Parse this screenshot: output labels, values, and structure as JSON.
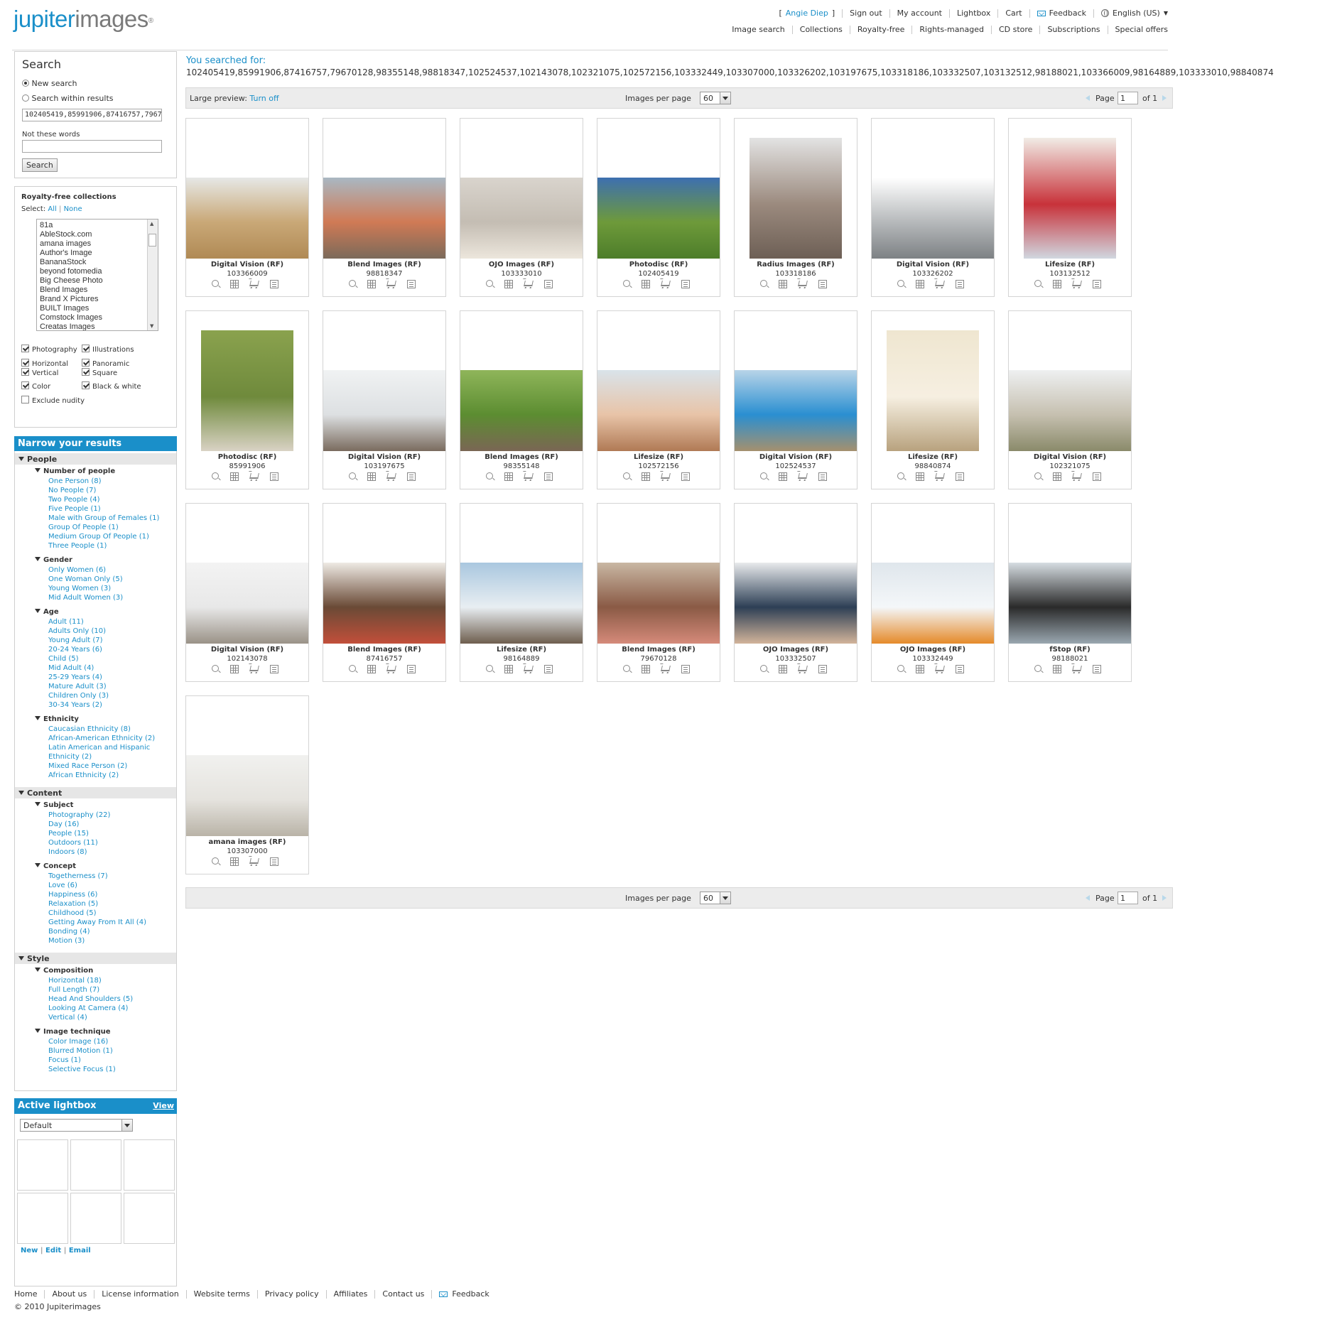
{
  "brand": {
    "logo_part1": "jupiter",
    "logo_part2": "images",
    "reg": "®"
  },
  "header": {
    "user_open": "[",
    "user": "Angie Diep",
    "user_close": "]",
    "top_links": [
      "Sign out",
      "My account",
      "Lightbox",
      "Cart"
    ],
    "feedback": "Feedback",
    "language": "English (US)",
    "nav_links": [
      "Image search",
      "Collections",
      "Royalty-free",
      "Rights-managed",
      "CD store",
      "Subscriptions",
      "Special offers"
    ]
  },
  "search_panel": {
    "title": "Search",
    "new_search": "New search",
    "within_results": "Search within results",
    "query_value": "102405419,85991906,87416757,79670128,98355148,98818347,102524537,102143078,102321075,102572156,103332449,103307000,103326202,103197675,103318186,103332507,103132512,98188021,103366009,98164889,103333010,98840874",
    "not_these_label": "Not these words",
    "not_these_value": "",
    "search_button": "Search"
  },
  "collections_panel": {
    "title": "Royalty-free collections",
    "select_label": "Select:",
    "select_all": "All",
    "select_none": "None",
    "items": [
      "81a",
      "AbleStock.com",
      "amana images",
      "Author's Image",
      "BananaStock",
      "beyond fotomedia",
      "Big Cheese Photo",
      "Blend Images",
      "Brand X Pictures",
      "BUILT Images",
      "Comstock Images",
      "Creatas Images"
    ],
    "filters": [
      {
        "label": "Photography",
        "checked": true
      },
      {
        "label": "Illustrations",
        "checked": true
      },
      {
        "label": "Horizontal",
        "checked": true
      },
      {
        "label": "Panoramic",
        "checked": true
      },
      {
        "label": "Vertical",
        "checked": true
      },
      {
        "label": "Square",
        "checked": true
      },
      {
        "label": "Color",
        "checked": true
      },
      {
        "label": "Black & white",
        "checked": true
      },
      {
        "label": "Exclude nudity",
        "checked": false
      }
    ]
  },
  "narrow": {
    "title": "Narrow your results",
    "sections": [
      {
        "title": "People",
        "groups": [
          {
            "title": "Number of people",
            "items": [
              "One Person (8)",
              "No People (7)",
              "Two People (4)",
              "Five People (1)",
              "Male with Group of Females (1)",
              "Group Of People (1)",
              "Medium Group Of People (1)",
              "Three People (1)"
            ]
          },
          {
            "title": "Gender",
            "items": [
              "Only Women (6)",
              "One Woman Only (5)",
              "Young Women (3)",
              "Mid Adult Women (3)"
            ]
          },
          {
            "title": "Age",
            "items": [
              "Adult (11)",
              "Adults Only (10)",
              "Young Adult (7)",
              "20-24 Years (6)",
              "Child (5)",
              "Mid Adult (4)",
              "25-29 Years (4)",
              "Mature Adult (3)",
              "Children Only (3)",
              "30-34 Years (2)"
            ]
          },
          {
            "title": "Ethnicity",
            "items": [
              "Caucasian Ethnicity (8)",
              "African-American Ethnicity (2)",
              "Latin American and Hispanic",
              "Ethnicity (2)",
              "Mixed Race Person (2)",
              "African Ethnicity (2)"
            ]
          }
        ]
      },
      {
        "title": "Content",
        "groups": [
          {
            "title": "Subject",
            "items": [
              "Photography (22)",
              "Day (16)",
              "People (15)",
              "Outdoors (11)",
              "Indoors (8)"
            ]
          },
          {
            "title": "Concept",
            "items": [
              "Togetherness (7)",
              "Love (6)",
              "Happiness (6)",
              "Relaxation (5)",
              "Childhood (5)",
              "Getting Away From It All (4)",
              "Bonding (4)",
              "Motion (3)"
            ]
          }
        ]
      },
      {
        "title": "Style",
        "groups": [
          {
            "title": "Composition",
            "items": [
              "Horizontal (18)",
              "Full Length (7)",
              "Head And Shoulders (5)",
              "Looking At Camera (4)",
              "Vertical (4)"
            ]
          },
          {
            "title": "Image technique",
            "items": [
              "Color Image (16)",
              "Blurred Motion (1)",
              "Focus (1)",
              "Selective Focus (1)"
            ]
          }
        ]
      }
    ]
  },
  "lightbox": {
    "title": "Active lightbox",
    "view": "View",
    "selected": "Default",
    "links": [
      "New",
      "Edit",
      "Email"
    ]
  },
  "results": {
    "searched_label": "You searched for:",
    "searched_value": "102405419,85991906,87416757,79670128,98355148,98818347,102524537,102143078,102321075,102572156,103332449,103307000,103326202,103197675,103318186,103332507,103132512,98188021,103366009,98164889,103333010,98840874",
    "preview_label": "Large preview:",
    "preview_toggle": "Turn off",
    "per_page_label": "Images per page",
    "per_page": "60",
    "page_label": "Page",
    "page": "1",
    "of_label": "of 1",
    "images": [
      {
        "source": "Digital Vision (RF)",
        "id": "103366009",
        "subject": "hands-holding-book-field",
        "colors": [
          "#e6e8e6",
          "#c9a877",
          "#b08a55"
        ],
        "orient": "h"
      },
      {
        "source": "Blend Images (RF)",
        "id": "98818347",
        "subject": "family-running-beach",
        "colors": [
          "#a9b8c3",
          "#d07a55",
          "#7b6a5a"
        ],
        "orient": "h"
      },
      {
        "source": "OJO Images (RF)",
        "id": "103333010",
        "subject": "string-lights-hearts",
        "colors": [
          "#d9d4cd",
          "#c4bdb3",
          "#ece6dc"
        ],
        "orient": "h"
      },
      {
        "source": "Photodisc (RF)",
        "id": "102405419",
        "subject": "dog-in-grass",
        "colors": [
          "#3d6fb0",
          "#6e9a3a",
          "#4d7d2a"
        ],
        "orient": "h"
      },
      {
        "source": "Radius Images (RF)",
        "id": "103318186",
        "subject": "climber-on-rock-peak",
        "colors": [
          "#e3e3e3",
          "#9b8a7e",
          "#6d5f55"
        ],
        "orient": "v"
      },
      {
        "source": "Digital Vision (RF)",
        "id": "103326202",
        "subject": "water-drop-splash",
        "colors": [
          "#ffffff",
          "#b6b9bb",
          "#7d8184"
        ],
        "orient": "h"
      },
      {
        "source": "Lifesize (RF)",
        "id": "103132512",
        "subject": "boy-with-crown-cape",
        "colors": [
          "#f1ece6",
          "#c8323a",
          "#d0d7e0"
        ],
        "orient": "v"
      },
      {
        "source": "Photodisc (RF)",
        "id": "85991906",
        "subject": "armchair-green-wall",
        "colors": [
          "#8aa24e",
          "#6f8a3c",
          "#d9d2c4"
        ],
        "orient": "v"
      },
      {
        "source": "Digital Vision (RF)",
        "id": "103197675",
        "subject": "couple-piggyback-farm",
        "colors": [
          "#f0f2f3",
          "#dde0e2",
          "#7a6b5e"
        ],
        "orient": "h"
      },
      {
        "source": "Blend Images (RF)",
        "id": "98355148",
        "subject": "boy-reading-grass",
        "colors": [
          "#8fb55a",
          "#5c8d31",
          "#7a6654"
        ],
        "orient": "h"
      },
      {
        "source": "Lifesize (RF)",
        "id": "102572156",
        "subject": "women-lounging-sun",
        "colors": [
          "#d9e3ea",
          "#e8c4a8",
          "#b07a55"
        ],
        "orient": "h"
      },
      {
        "source": "Digital Vision (RF)",
        "id": "102524537",
        "subject": "infinity-pool-resort",
        "colors": [
          "#b8d4e8",
          "#2a8fd1",
          "#a5906e"
        ],
        "orient": "h"
      },
      {
        "source": "Lifesize (RF)",
        "id": "98840874",
        "subject": "woman-at-table",
        "colors": [
          "#efe6d0",
          "#f6efe1",
          "#b8a27e"
        ],
        "orient": "v"
      },
      {
        "source": "Digital Vision (RF)",
        "id": "102321075",
        "subject": "woman-running-dunes",
        "colors": [
          "#eef0f1",
          "#c6c0b0",
          "#8a8a6a"
        ],
        "orient": "h"
      },
      {
        "source": "Digital Vision (RF)",
        "id": "102143078",
        "subject": "cat-walking",
        "colors": [
          "#f3f3f3",
          "#e8e8e8",
          "#9a9287"
        ],
        "orient": "h"
      },
      {
        "source": "Blend Images (RF)",
        "id": "87416757",
        "subject": "scientist-molecule-model",
        "colors": [
          "#eeeae4",
          "#6a4a36",
          "#c24f3a"
        ],
        "orient": "h"
      },
      {
        "source": "Lifesize (RF)",
        "id": "98164889",
        "subject": "couple-on-boat",
        "colors": [
          "#a9c7df",
          "#e8eef2",
          "#6e5e4e"
        ],
        "orient": "h"
      },
      {
        "source": "Blend Images (RF)",
        "id": "79670128",
        "subject": "family-hugging",
        "colors": [
          "#c9b7a3",
          "#8a5a45",
          "#d58a7a"
        ],
        "orient": "h"
      },
      {
        "source": "OJO Images (RF)",
        "id": "103332507",
        "subject": "businessman-smiling",
        "colors": [
          "#e8eaec",
          "#2d3f55",
          "#d2b49a"
        ],
        "orient": "h"
      },
      {
        "source": "OJO Images (RF)",
        "id": "103332449",
        "subject": "goldfish-bowl",
        "colors": [
          "#dfe6ec",
          "#f4f7f9",
          "#e58a2a"
        ],
        "orient": "h"
      },
      {
        "source": "fStop (RF)",
        "id": "98188021",
        "subject": "ballet-dancers-leaping",
        "colors": [
          "#d6dde2",
          "#2a2a2a",
          "#9aa7b0"
        ],
        "orient": "h"
      },
      {
        "source": "amana images (RF)",
        "id": "103307000",
        "subject": "bright-room-window",
        "colors": [
          "#f1f1ef",
          "#e5e3de",
          "#b9b3a7"
        ],
        "orient": "h"
      }
    ]
  },
  "footer": {
    "links": [
      "Home",
      "About us",
      "License information",
      "Website terms",
      "Privacy policy",
      "Affiliates",
      "Contact us"
    ],
    "feedback": "Feedback",
    "copyright": "© 2010 Jupiterimages"
  }
}
